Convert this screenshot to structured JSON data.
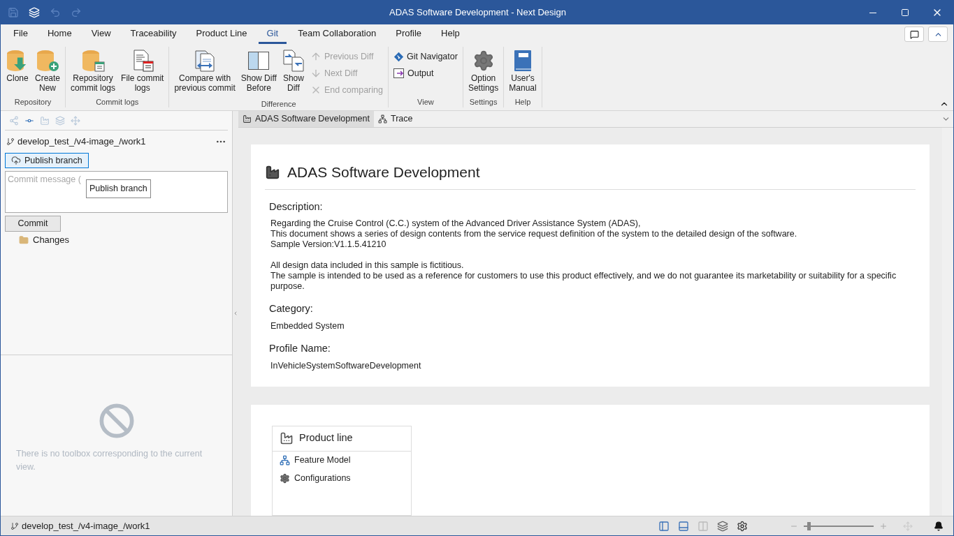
{
  "window": {
    "title": "ADAS Software Development - Next Design"
  },
  "menu_tabs": [
    {
      "label": "File",
      "selected": false
    },
    {
      "label": "Home",
      "selected": false
    },
    {
      "label": "View",
      "selected": false
    },
    {
      "label": "Traceability",
      "selected": false
    },
    {
      "label": "Product Line",
      "selected": false
    },
    {
      "label": "Git",
      "selected": true
    },
    {
      "label": "Team Collaboration",
      "selected": false
    },
    {
      "label": "Profile",
      "selected": false
    },
    {
      "label": "Help",
      "selected": false
    }
  ],
  "ribbon_groups": [
    {
      "label": "Repository",
      "items": [
        {
          "kind": "large",
          "label_lines": [
            "Clone"
          ]
        },
        {
          "kind": "large",
          "label_lines": [
            "Create",
            "New"
          ]
        }
      ]
    },
    {
      "label": "Commit logs",
      "items": [
        {
          "kind": "large",
          "label_lines": [
            "Repository",
            "commit logs"
          ]
        },
        {
          "kind": "large",
          "label_lines": [
            "File commit",
            "logs"
          ]
        }
      ]
    },
    {
      "label": "Difference",
      "items": [
        {
          "kind": "large",
          "label_lines": [
            "Compare with",
            "previous commit"
          ]
        },
        {
          "kind": "large",
          "label_lines": [
            "Show Diff",
            "Before"
          ]
        },
        {
          "kind": "large",
          "label_lines": [
            "Show",
            "Diff"
          ]
        },
        {
          "kind": "stack",
          "items": [
            {
              "label": "Previous Diff",
              "disabled": true
            },
            {
              "label": "Next Diff",
              "disabled": true
            },
            {
              "label": "End comparing",
              "disabled": true
            }
          ]
        }
      ]
    },
    {
      "label": "View",
      "items": [
        {
          "kind": "stack",
          "items": [
            {
              "label": "Git Navigator",
              "disabled": false
            },
            {
              "label": "Output",
              "disabled": false
            }
          ]
        }
      ]
    },
    {
      "label": "Settings",
      "items": [
        {
          "kind": "large",
          "label_lines": [
            "Option",
            "Settings"
          ]
        }
      ]
    },
    {
      "label": "Help",
      "items": [
        {
          "kind": "large",
          "label_lines": [
            "User's",
            "Manual"
          ]
        }
      ]
    }
  ],
  "left_panel": {
    "branch": "develop_test_/v4-image_/work1",
    "publish_button": "Publish branch",
    "tooltip": "Publish branch",
    "commit_message": {
      "placeholder": "Commit message ("
    },
    "commit_button": "Commit",
    "tree": [
      {
        "label": "Changes",
        "expanded": false
      }
    ],
    "toolbox_message": "There is no toolbox corresponding to the current view."
  },
  "doc_tabs": [
    {
      "label": "ADAS Software Development",
      "selected": true
    },
    {
      "label": "Trace",
      "selected": false
    }
  ],
  "document": {
    "title": "ADAS Software Development",
    "sections": [
      {
        "heading": "Description:",
        "paragraphs": [
          [
            "Regarding the Cruise Control (C.C.) system of the Advanced Driver Assistance System (ADAS),",
            "This document shows a series of design contents from the service request definition of the system to the detailed design of the software.",
            "Sample Version:V1.1.5.41210"
          ],
          [
            "All design data included in this sample is fictitious.",
            "The sample is intended to be used as a reference for customers to use this product effectively, and we do not guarantee its marketability or suitability for a specific purpose."
          ]
        ]
      },
      {
        "heading": "Category:",
        "paragraphs": [
          [
            "Embedded System"
          ]
        ]
      },
      {
        "heading": "Profile Name:",
        "paragraphs": [
          [
            "InVehicleSystemSoftwareDevelopment"
          ]
        ]
      }
    ]
  },
  "product_line": {
    "title": "Product line",
    "items": [
      {
        "label": "Feature Model"
      },
      {
        "label": "Configurations"
      }
    ]
  },
  "status_bar": {
    "branch": "develop_test_/v4-image_/work1",
    "zoom": {
      "level": 0.05
    }
  }
}
